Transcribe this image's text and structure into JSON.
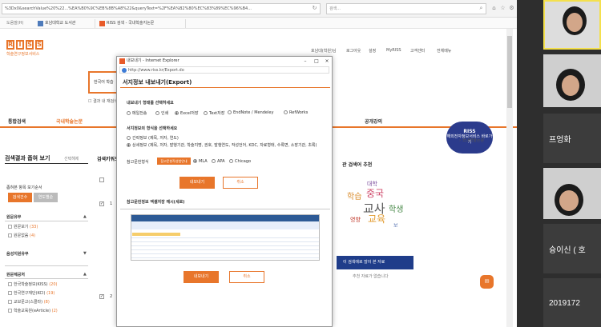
{
  "browser": {
    "url": "%3Dx0&searchValue%20%22...%EA%B0%9C%EB%8B%A8%22&queryText=%2F%EA%B2%80%EC%83%89%EC%96%B4...",
    "search_placeholder": "검색...",
    "tabs": [
      {
        "label": "호남대학교 도서관"
      },
      {
        "label": "RISS 검색 - 국내학술지논문"
      }
    ],
    "fav_label": "도움말(H)"
  },
  "site": {
    "logo_letters": [
      "R",
      "I",
      "S",
      "S"
    ],
    "logo_sub": "학술연구정보서비스",
    "top_links": [
      "호남대(학원)님",
      "로그아웃",
      "설정",
      "MyRISS",
      "고객센터",
      "전체메뉴"
    ],
    "search_text": "한국어 학습",
    "search_option": "결과 내 재검색",
    "nav": [
      "통합검색",
      "국내학술논문",
      "공개강의"
    ],
    "badge": "해외전자정보서비스 바로가기",
    "breadcrumb": "› 국내학술논문"
  },
  "left": {
    "title": "검색결과 좁혀 보기",
    "select_link": "선택해제",
    "sort_label": "좁혀본 항목 보기순서",
    "sort_buttons": [
      "검색건수",
      "연도별순"
    ],
    "facets": [
      {
        "title": "원문유무",
        "items": [
          {
            "label": "원문보기",
            "count": "(33)"
          },
          {
            "label": "원문없음",
            "count": "(4)"
          }
        ]
      },
      {
        "title": "음성지원유무",
        "items": []
      },
      {
        "title": "원문제공처",
        "items": [
          {
            "label": "한국학술정보(KISS)",
            "count": "(20)"
          },
          {
            "label": "한국연구재단(KCI)",
            "count": "(19)"
          },
          {
            "label": "교보문고(스콜라)",
            "count": "(8)"
          },
          {
            "label": "학술교육원(eArticle)",
            "count": "(2)"
          }
        ]
      }
    ]
  },
  "results": {
    "header": "검색키워드",
    "row_numbers": [
      "1",
      "2"
    ]
  },
  "right": {
    "title": "관 검색어 추천",
    "words": [
      "대학",
      "학습",
      "중국",
      "교사",
      "학생",
      "영향",
      "교육",
      "보"
    ],
    "bar": "이 검색에로 많이 본 자료",
    "note": "추천 자료가 없습니다"
  },
  "popup": {
    "window_title": "내보내기 - Internet Explorer",
    "url": "http://www.riss.kr/Export.do",
    "heading": "서지정보 내보내기(Export)",
    "section1_label": "내보내기 형태를 선택하세요",
    "formats": [
      {
        "label": "메일전송",
        "selected": false
      },
      {
        "label": "인쇄",
        "selected": false
      },
      {
        "label": "Excel저장",
        "selected": true
      },
      {
        "label": "Text저장",
        "selected": false
      },
      {
        "label": "EndNote / Mendeley",
        "selected": false
      },
      {
        "label": "RefWorks",
        "selected": false
      }
    ],
    "section2_label": "서지정보의 형식을 선택하세요",
    "info_options": [
      {
        "label": "간략정보 (제목, 저자, 연도)",
        "selected": false
      },
      {
        "label": "상세정보 (제목, 저자, 발행기관, 학술지명, 권호, 발행연도, 작성언어, KDC, 자료형태, 수록면, 소장기관, 초록)",
        "selected": true
      }
    ],
    "ref_label": "참고문헌형식",
    "ref_badge": "참고문헌작성법안내",
    "ref_styles": [
      {
        "label": "MLA",
        "selected": true
      },
      {
        "label": "APA",
        "selected": false
      },
      {
        "label": "Chicago",
        "selected": false
      }
    ],
    "export_label": "내보내기",
    "cancel_label": "취소",
    "example_label": "참고문헌정보 엑셀저장 예시(세로)",
    "export_label2": "내보내기",
    "cancel_label2": "취소"
  },
  "video": {
    "participants": [
      "프엉화",
      "슝이신 ( 호",
      "2019172"
    ]
  }
}
